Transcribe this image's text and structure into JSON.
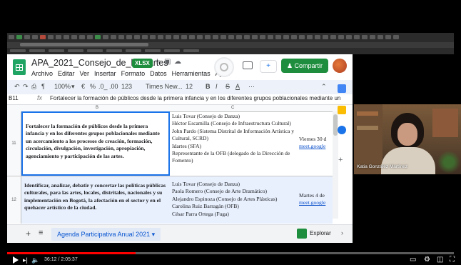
{
  "sheet": {
    "title": "APA_2021_Consejo_de_las_Artes",
    "file_badge": "XLSX",
    "menu": [
      "Archivo",
      "Editar",
      "Ver",
      "Insertar",
      "Formato",
      "Datos",
      "Herramientas",
      "Ayud"
    ],
    "share_label": "Compartir",
    "toolbar": {
      "zoom": "100%",
      "currency": "€",
      "percent": "%",
      "decimals": ".0_ .00",
      "number_format": "123",
      "font": "Times New...",
      "font_size": "12",
      "bold": "B",
      "italic": "I",
      "strike": "S",
      "text_color": "A",
      "more": "⋯"
    },
    "formula_bar": {
      "cell_ref": "B11",
      "fx": "fx",
      "content": "Fortalecer la formación de públicos desde la primera infancia y en los diferentes grupos poblacionales mediante un"
    },
    "col_headers": [
      "B",
      "C"
    ],
    "rows": [
      {
        "num": "11",
        "b": "Fortalecer la formación de públicos desde la primera infancia y en los diferentes grupos poblacionales mediante un acercamiento a los procesos de creación, formación, circulación, divulgación, investigación, apropiación, agenciamiento y participación de las artes.",
        "c": [
          "Luis Tovar (Consejo de Danza)",
          "Héctor Escamilla (Consejo de Infraestructura Cultural)",
          "John Pardo (Sistema Distrital de Información Artística y Cultural, SCRD)",
          "Idartes (SFA)",
          "Representante de la OFB (delegado de la Dirección de Fomento)"
        ],
        "d_date": "Viernes 30 d",
        "d_link": "meet.google"
      },
      {
        "num": "12",
        "b": "Identificar, analizar, debatir y concertar las políticas públicas culturales, para las artes, locales, distritales, nacionales y su implementación en Bogotá, la afectación en el sector y en el quehacer artístico de la ciudad.",
        "c": [
          "Luis Tovar (Consejo de Danza)",
          "Paola Romero (Consejo de Arte Dramático)",
          "Alejandro Espinoza (Consejo de Artes Plásticas)",
          "Carolina Ruiz Barragán (OFB)",
          "César Parra Ortega (Fuga)"
        ],
        "d_date": "Martes 4 de",
        "d_link": "meet.google"
      }
    ],
    "bottom": {
      "add": "+",
      "list": "≡",
      "sheet_tab": "Agenda Participativa Anual 2021",
      "explore": "Explorar"
    }
  },
  "webcam": {
    "participant_name": "Katia González Martínez"
  },
  "video": {
    "time": "36:12 / 2:05:37",
    "progress_fraction": 0.288
  },
  "colors": {
    "sheets_green": "#1e8e3e",
    "row_selected": "#e8f0fe",
    "progress_red": "#ff0000",
    "link_blue": "#1155cc"
  }
}
